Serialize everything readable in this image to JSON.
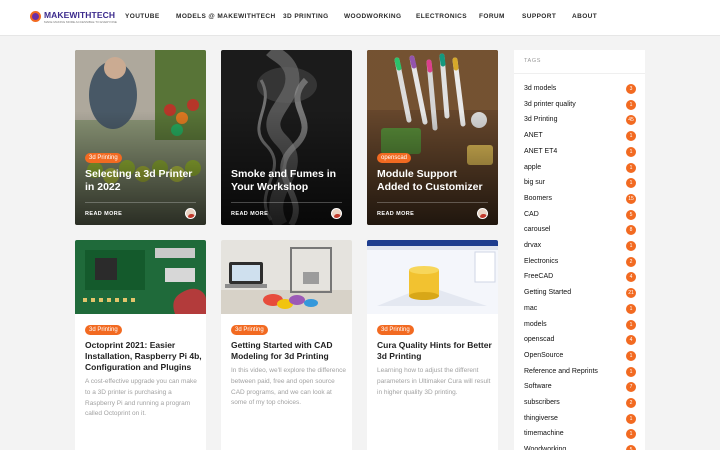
{
  "brand": {
    "name": "MAKEWITHTECH",
    "tagline": "MAKE MAKING MORE ACCESSIBLE TO EVERYONE",
    "accent": "#f26a21",
    "logo_color": "#3b2a8c"
  },
  "nav": [
    "YOUTUBE",
    "MODELS @ MAKEWITHTECH",
    "3D PRINTING",
    "WOODWORKING",
    "ELECTRONICS",
    "FORUM",
    "SUPPORT",
    "ABOUT"
  ],
  "featured": [
    {
      "category": "3d Printing",
      "title": "Selecting a 3d Printer in 2022",
      "read_more": "READ MORE",
      "image": "grocery-produce-photo"
    },
    {
      "category": "",
      "title": "Smoke and Fumes in Your Workshop",
      "read_more": "READ MORE",
      "image": "smoke-photo"
    },
    {
      "category": "openscad",
      "title": "Module Support Added to Customizer",
      "read_more": "READ MORE",
      "image": "markers-on-desk-photo"
    }
  ],
  "posts": [
    {
      "category": "3d Printing",
      "title": "Octoprint 2021: Easier Installation, Raspberry Pi 4b, Configuration and Plugins",
      "excerpt": "A cost-effective upgrade you can make to a 3D printer is purchasing a Raspberry Pi and running a program called Octoprint on it.",
      "image": "raspberry-pi-board-photo"
    },
    {
      "category": "3d Printing",
      "title": "Getting Started with CAD Modeling for 3d Printing",
      "excerpt": "In this video, we'll explore the difference between paid, free and open source CAD programs, and we can look at some of my top choices.",
      "image": "laptop-and-3d-printer-photo"
    },
    {
      "category": "3d Printing",
      "title": "Cura Quality Hints for Better 3d Printing",
      "excerpt": "Learning how to adjust the different parameters in Ultimaker Cura will result in higher quality 3D printing.",
      "image": "cura-slicer-screenshot"
    }
  ],
  "sidebar": {
    "heading": "TAGS",
    "tags": [
      {
        "name": "3d models",
        "count": "3"
      },
      {
        "name": "3d printer quality",
        "count": "1"
      },
      {
        "name": "3d Printing",
        "count": "45"
      },
      {
        "name": "ANET",
        "count": "1"
      },
      {
        "name": "ANET ET4",
        "count": "1"
      },
      {
        "name": "apple",
        "count": "1"
      },
      {
        "name": "big sur",
        "count": "1"
      },
      {
        "name": "Boomers",
        "count": "15"
      },
      {
        "name": "CAD",
        "count": "5"
      },
      {
        "name": "carousel",
        "count": "8"
      },
      {
        "name": "drvax",
        "count": "1"
      },
      {
        "name": "Electronics",
        "count": "2"
      },
      {
        "name": "FreeCAD",
        "count": "4"
      },
      {
        "name": "Getting Started",
        "count": "21"
      },
      {
        "name": "mac",
        "count": "1"
      },
      {
        "name": "models",
        "count": "1"
      },
      {
        "name": "openscad",
        "count": "4"
      },
      {
        "name": "OpenSource",
        "count": "1"
      },
      {
        "name": "Reference and Reprints",
        "count": "1"
      },
      {
        "name": "Software",
        "count": "7"
      },
      {
        "name": "subscribers",
        "count": "2"
      },
      {
        "name": "thingiverse",
        "count": "1"
      },
      {
        "name": "timemachine",
        "count": "1"
      },
      {
        "name": "Woodworking",
        "count": "5"
      }
    ]
  }
}
